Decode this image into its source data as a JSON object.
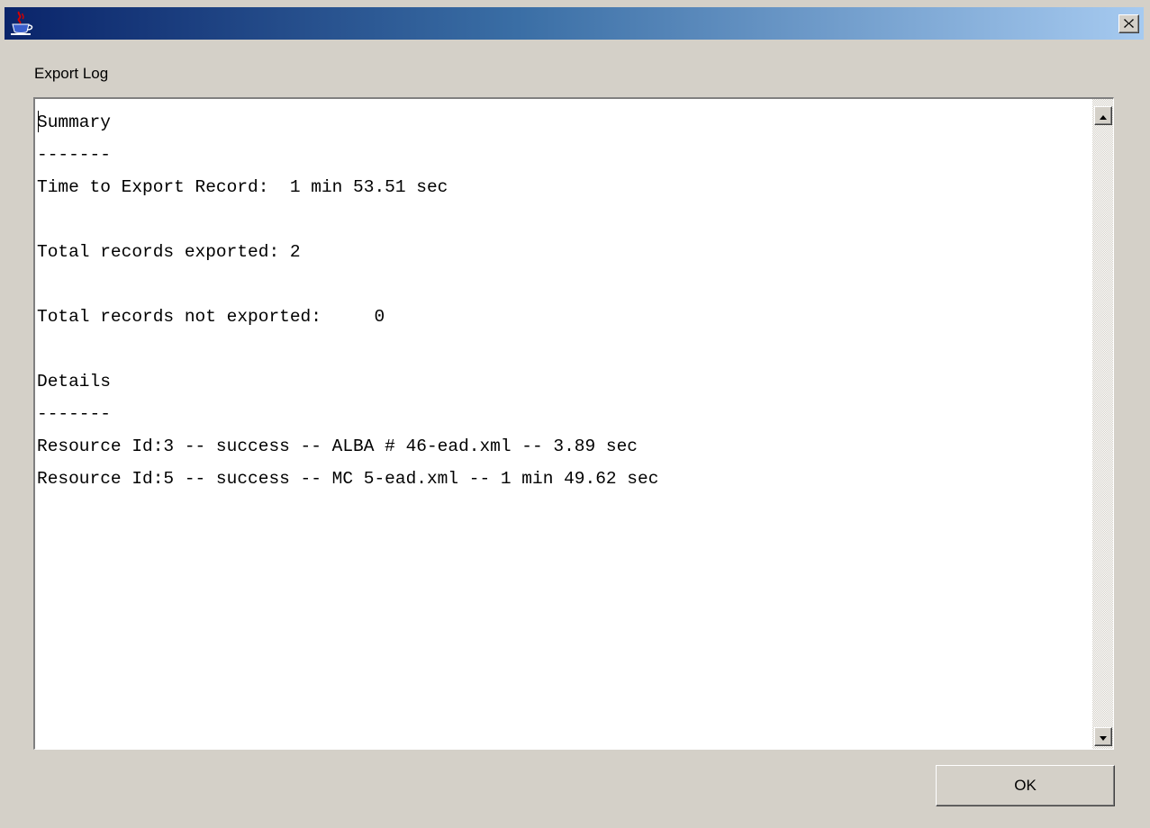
{
  "window": {
    "title": "",
    "icon": "java-cup-icon",
    "close_icon": "close-icon"
  },
  "log": {
    "label": "Export Log",
    "text": "Summary\n-------\nTime to Export Record:  1 min 53.51 sec\n\nTotal records exported: 2\n\nTotal records not exported:     0\n\nDetails\n-------\nResource Id:3 -- success -- ALBA # 46-ead.xml -- 3.89 sec\nResource Id:5 -- success -- MC 5-ead.xml -- 1 min 49.62 sec"
  },
  "buttons": {
    "ok_label": "OK"
  },
  "colors": {
    "titlebar_start": "#0a246a",
    "titlebar_end": "#a6caf0",
    "dialog_background": "#d4d0c8"
  }
}
